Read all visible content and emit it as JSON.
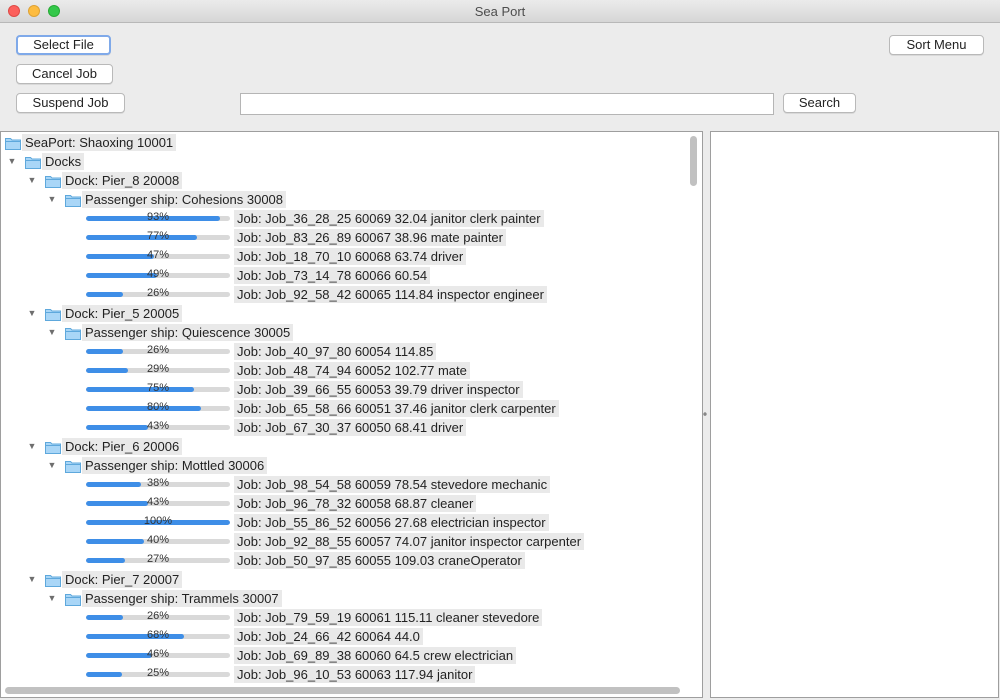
{
  "window": {
    "title": "Sea Port"
  },
  "toolbar": {
    "select_file": "Select File",
    "cancel_job": "Cancel Job",
    "suspend_job": "Suspend Job",
    "search_value": "",
    "search_button": "Search",
    "sort_menu": "Sort Menu"
  },
  "tree": {
    "root": "SeaPort: Shaoxing 10001",
    "docks_label": "Docks",
    "docks": [
      {
        "label": "Dock: Pier_8 20008",
        "ship": "Passenger ship: Cohesions 30008",
        "jobs": [
          {
            "progress": 93,
            "progress_text": "93%",
            "label": "Job: Job_36_28_25 60069 32.04 janitor clerk painter"
          },
          {
            "progress": 77,
            "progress_text": "77%",
            "label": "Job: Job_83_26_89 60067 38.96 mate painter"
          },
          {
            "progress": 47,
            "progress_text": "47%",
            "label": "Job: Job_18_70_10 60068 63.74 driver"
          },
          {
            "progress": 49,
            "progress_text": "49%",
            "label": "Job: Job_73_14_78 60066 60.54"
          },
          {
            "progress": 26,
            "progress_text": "26%",
            "label": "Job: Job_92_58_42 60065 114.84 inspector engineer"
          }
        ]
      },
      {
        "label": "Dock: Pier_5 20005",
        "ship": "Passenger ship: Quiescence 30005",
        "jobs": [
          {
            "progress": 26,
            "progress_text": "26%",
            "label": "Job: Job_40_97_80 60054 114.85"
          },
          {
            "progress": 29,
            "progress_text": "29%",
            "label": "Job: Job_48_74_94 60052 102.77 mate"
          },
          {
            "progress": 75,
            "progress_text": "75%",
            "label": "Job: Job_39_66_55 60053 39.79 driver inspector"
          },
          {
            "progress": 80,
            "progress_text": "80%",
            "label": "Job: Job_65_58_66 60051 37.46 janitor clerk carpenter"
          },
          {
            "progress": 43,
            "progress_text": "43%",
            "label": "Job: Job_67_30_37 60050 68.41 driver"
          }
        ]
      },
      {
        "label": "Dock: Pier_6 20006",
        "ship": "Passenger ship: Mottled 30006",
        "jobs": [
          {
            "progress": 38,
            "progress_text": "38%",
            "label": "Job: Job_98_54_58 60059 78.54 stevedore mechanic"
          },
          {
            "progress": 43,
            "progress_text": "43%",
            "label": "Job: Job_96_78_32 60058 68.87 cleaner"
          },
          {
            "progress": 100,
            "progress_text": "100%",
            "label": "Job: Job_55_86_52 60056 27.68 electrician inspector"
          },
          {
            "progress": 40,
            "progress_text": "40%",
            "label": "Job: Job_92_88_55 60057 74.07 janitor inspector carpenter"
          },
          {
            "progress": 27,
            "progress_text": "27%",
            "label": "Job: Job_50_97_85 60055 109.03 craneOperator"
          }
        ]
      },
      {
        "label": "Dock: Pier_7 20007",
        "ship": "Passenger ship: Trammels 30007",
        "jobs": [
          {
            "progress": 26,
            "progress_text": "26%",
            "label": "Job: Job_79_59_19 60061 115.11 cleaner stevedore"
          },
          {
            "progress": 68,
            "progress_text": "68%",
            "label": "Job: Job_24_66_42 60064 44.0"
          },
          {
            "progress": 46,
            "progress_text": "46%",
            "label": "Job: Job_69_89_38 60060 64.5 crew electrician"
          },
          {
            "progress": 25,
            "progress_text": "25%",
            "label": "Job: Job_96_10_53 60063 117.94 janitor"
          }
        ]
      }
    ]
  },
  "icons": {
    "folder": "folder-icon",
    "expanded": "triangle-down-icon"
  },
  "colors": {
    "progress_fill": "#3e8ee7",
    "folder": "#8ec8f2"
  }
}
